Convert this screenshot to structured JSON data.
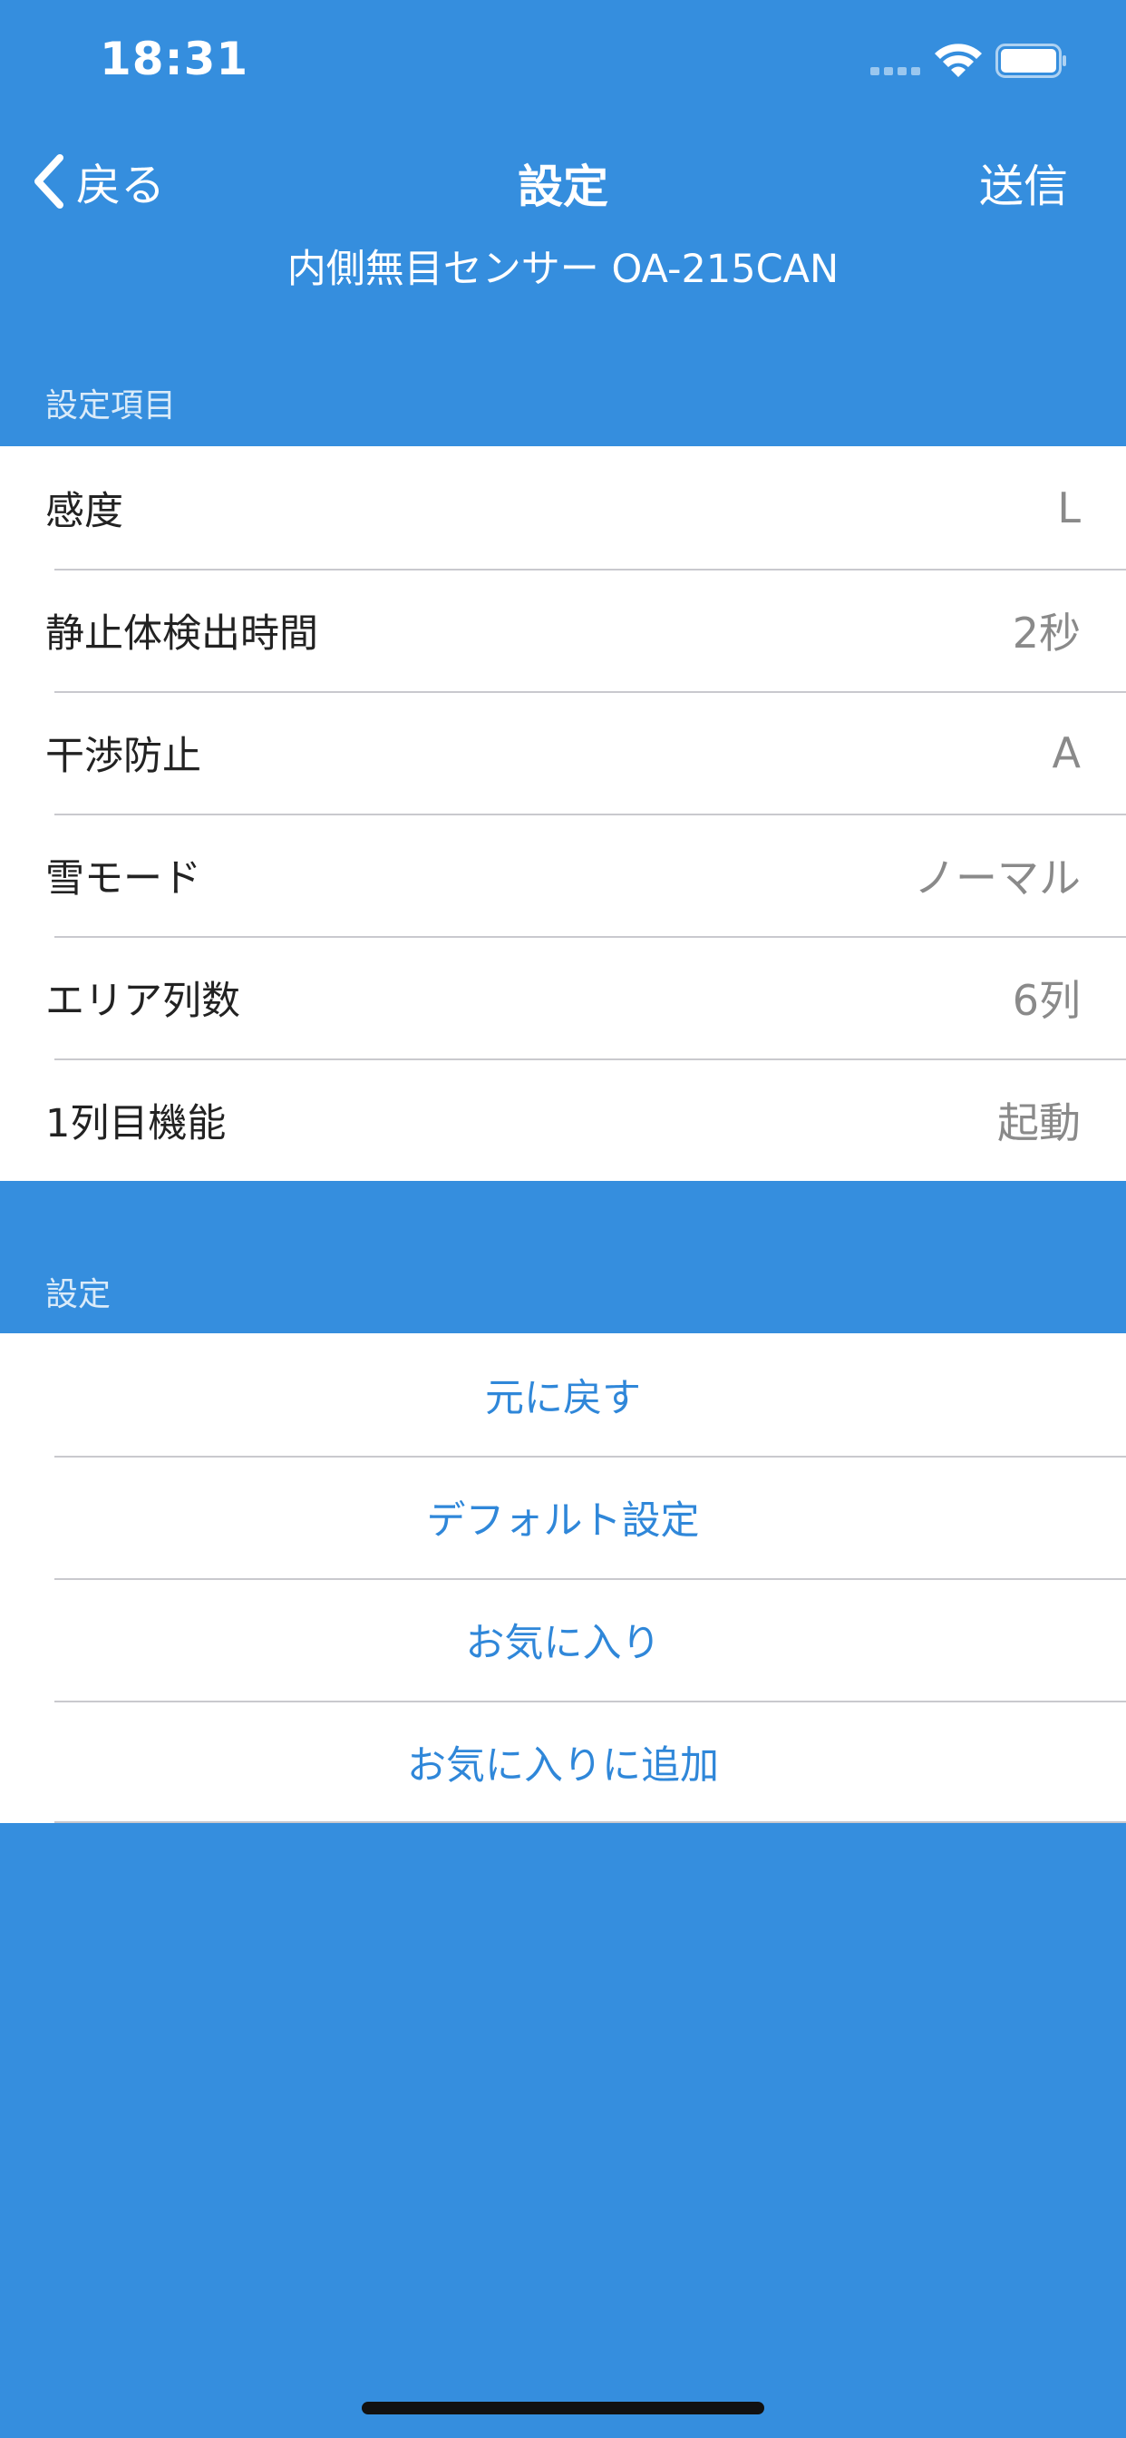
{
  "status_bar": {
    "time": "18:31"
  },
  "nav": {
    "back_label": "戻る",
    "title": "設定",
    "send_label": "送信",
    "device_name": "内側無目センサー OA-215CAN"
  },
  "settings_section": {
    "header": "設定項目",
    "items": [
      {
        "label": "感度",
        "value": "L"
      },
      {
        "label": "静止体検出時間",
        "value": "2秒"
      },
      {
        "label": "干渉防止",
        "value": "A"
      },
      {
        "label": "雪モード",
        "value": "ノーマル"
      },
      {
        "label": "エリア列数",
        "value": "6列"
      },
      {
        "label": "1列目機能",
        "value": "起動"
      }
    ]
  },
  "actions_section": {
    "header": "設定",
    "items": [
      {
        "label": "元に戻す"
      },
      {
        "label": "デフォルト設定"
      },
      {
        "label": "お気に入り"
      },
      {
        "label": "お気に入りに追加"
      }
    ]
  },
  "colors": {
    "background": "#358ede",
    "action_text": "#2f87d9",
    "value_text": "#8a8a8a"
  }
}
